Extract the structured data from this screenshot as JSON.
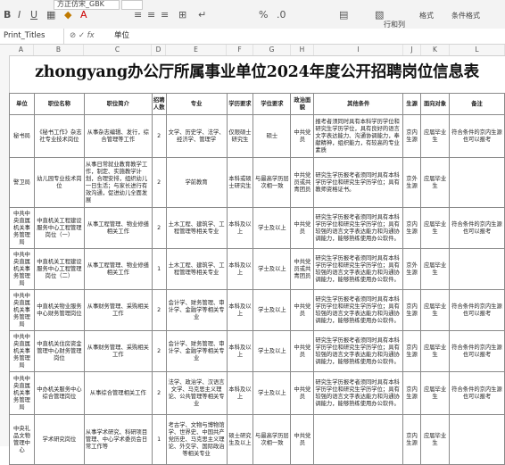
{
  "ribbon": {
    "font_name": "方正仿宋_GBK",
    "format_label": "格式",
    "sort_filter_label": "条件格式",
    "row_col_label": "行和列"
  },
  "formula_bar": {
    "name_box": "Print_Titles",
    "fx": "fx",
    "value": "单位"
  },
  "columns": [
    "A",
    "B",
    "C",
    "D",
    "E",
    "F",
    "G",
    "H",
    "I",
    "J",
    "K",
    "L"
  ],
  "sheet": {
    "title": "zhongyang办公厅所属事业单位2024年度公开招聘岗位信息表",
    "headers": [
      "单位",
      "职位名称",
      "职位简介",
      "招聘人数",
      "专业",
      "学历要求",
      "学位要求",
      "政治面貌",
      "其他条件",
      "生源",
      "面向对象",
      "备注"
    ],
    "rows": [
      [
        "秘书局",
        "《秘书工作》杂志社专业技术岗位",
        "从事杂志编辑、发行，综合管理等工作",
        "2",
        "文学、历史学、法学、经济学、管理学",
        "仅限硕士研究生",
        "硕士",
        "中共党员",
        "报考者须同时具有本科学历学位和研究生学历学位，具有良好的语言文字表达能力、沟通协调能力，奉献精神，组织能力，有较高的专业素质",
        "京内生源",
        "应届毕业生",
        "符合条件的京内生源也可以报考"
      ],
      [
        "警卫局",
        "幼儿园专业技术岗位",
        "从事日常就业教育教学工作，制定、实施教学计划，合理安排，组织幼儿一日生活；与家长进行有效沟通，促进幼儿全面发展",
        "2",
        "学前教育",
        "本科或硕士研究生",
        "与最高学历层次相一致",
        "中共党员或共青团员",
        "研究生学历报考者须同时具有本科学历学位和研究生学历学位；具有教师资格证书。",
        "京外生源",
        "应届毕业生",
        ""
      ],
      [
        "中共中央直属机关事务管理局",
        "中直机关工程建设服务中心工程管理岗位（一）",
        "从事工程管理、物业修缮相关工作",
        "2",
        "土木工程、建筑学、工程管理等相关专业",
        "本科及以上",
        "学士及以上",
        "中共党员",
        "研究生学历报考者须同时具有本科学历学位和研究生学历学位；具有较强的语言文字表达能力和沟通协调能力，能够熟练使用办公软件。",
        "京内生源",
        "应届毕业生",
        "符合条件的京内生源也可以报考"
      ],
      [
        "中共中央直属机关事务管理局",
        "中直机关工程建设服务中心工程管理岗位（二）",
        "从事工程管理、物业修缮相关工作",
        "1",
        "土木工程、建筑学、工程管理等相关专业",
        "本科及以上",
        "学士及以上",
        "中共党员或共青团员",
        "研究生学历报考者须同时具有本科学历学位和研究生学历学位；具有较强的语言文字表达能力和沟通协调能力，能够熟练使用办公软件。",
        "京外生源",
        "应届毕业生",
        ""
      ],
      [
        "中共中央直属机关事务管理局",
        "中直机关物业服务中心财务管理岗位",
        "从事财务管理、采购相关工作",
        "2",
        "会计学、财务管理、审计学、金融学等相关专业",
        "本科及以上",
        "学士及以上",
        "中共党员",
        "研究生学历报考者须同时具有本科学历学位和研究生学历学位；具有较强的语言文字表达能力和沟通协调能力，能够熟练使用办公软件。",
        "京内生源",
        "应届毕业生",
        "符合条件的京内生源也可以报考"
      ],
      [
        "中共中央直属机关事务管理局",
        "中直机关住房资金管理中心财务管理岗位",
        "从事财务管理、采购相关工作",
        "2",
        "会计学、财务管理、审计学、金融学等相关专业",
        "本科及以上",
        "学士及以上",
        "中共党员",
        "研究生学历报考者须同时具有本科学历学位和研究生学历学位；具有较强的语言文字表达能力和沟通协调能力，能够熟练使用办公软件。",
        "京内生源",
        "应届毕业生",
        "符合条件的京内生源也可以报考"
      ],
      [
        "中共中央直属机关事务管理局",
        "中办机关服务中心综合管理岗位",
        "从事综合管理相关工作",
        "2",
        "法学、政治学、汉语言文学、马克思主义理论、公共管理等相关专业",
        "本科及以上",
        "学士及以上",
        "中共党员",
        "研究生学历报考者须同时具有本科学历学位和研究生学历学位；具有较强的语言文字表达能力和沟通协调能力，能够熟练使用办公软件。",
        "京内生源",
        "应届毕业生",
        "符合条件的京内生源也可以报考"
      ],
      [
        "中央礼品文物管理中心",
        "学术研究岗位",
        "从事学术研究、科研项目管理、中心学术委员会日常工作等",
        "1",
        "考古学、文物与博物馆学、世界史、中国共产党历史、马克思主义理论、外交学、国际政治等相关专业",
        "硕士研究生及以上",
        "与最高学历层次相一致",
        "中共党员",
        "",
        "京内生源",
        "应届毕业生",
        ""
      ]
    ]
  }
}
